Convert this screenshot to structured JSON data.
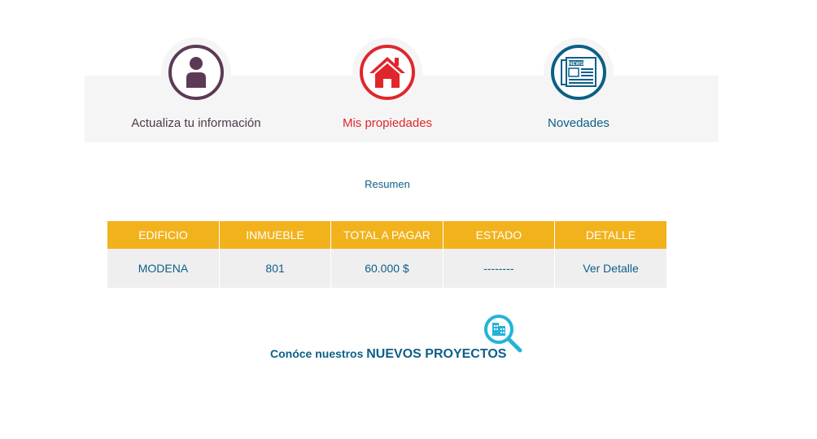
{
  "nav": {
    "items": [
      {
        "label": "Actualiza tu información",
        "icon": "user-icon",
        "color": "#5c3a55"
      },
      {
        "label": "Mis propiedades",
        "icon": "house-icon",
        "color": "#e0262d"
      },
      {
        "label": "Novedades",
        "icon": "newspaper-icon",
        "color": "#0d5f87",
        "icon_text": "NEWS"
      }
    ]
  },
  "summary": {
    "title": "Resumen",
    "columns": [
      "EDIFICIO",
      "INMUEBLE",
      "TOTAL A PAGAR",
      "ESTADO",
      "DETALLE"
    ],
    "rows": [
      {
        "edificio": "MODENA",
        "inmueble": "801",
        "total": "60.000 $",
        "estado": "--------",
        "detalle": "Ver Detalle"
      }
    ],
    "header_color": "#f2b21c"
  },
  "promo": {
    "prefix": "Conóce nuestros ",
    "highlight": "NUEVOS PROYECTOS",
    "icon": "building-search-icon"
  }
}
